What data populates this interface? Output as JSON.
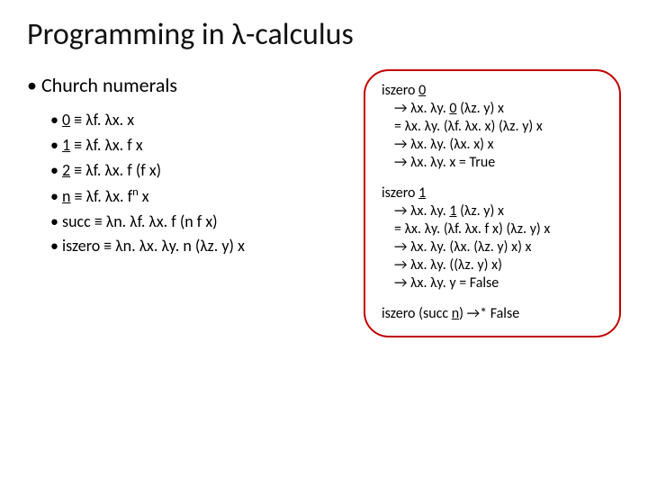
{
  "title": "Programming in λ-calculus",
  "heading": "Church numerals",
  "defs": {
    "zero": "0 ≡ λf. λx. x",
    "one": "1 ≡ λf. λx. f x",
    "two": "2 ≡ λf. λx. f (f x)",
    "n": "n ≡ λf. λx. fⁿ x",
    "succ": "succ ≡ λn. λf. λx. f (n f x)",
    "iszero": "iszero ≡ λn. λx. λy. n (λz. y) x"
  },
  "ex1": {
    "head": "iszero 0",
    "l1": "→ λx. λy. 0 (λz. y) x",
    "l2": "= λx. λy. (λf. λx. x) (λz. y) x",
    "l3": "→ λx. λy. (λx. x) x",
    "l4": "→ λx. λy. x = True"
  },
  "ex2": {
    "head": "iszero 1",
    "l1": "→ λx. λy. 1 (λz. y) x",
    "l2": "= λx. λy. (λf. λx. f x) (λz. y) x",
    "l3": "→ λx. λy. (λx. (λz. y) x) x",
    "l4": "→ λx. λy. ((λz. y) x)",
    "l5": "→ λx. λy. y  = False"
  },
  "ex3": "iszero (succ n) →* False"
}
